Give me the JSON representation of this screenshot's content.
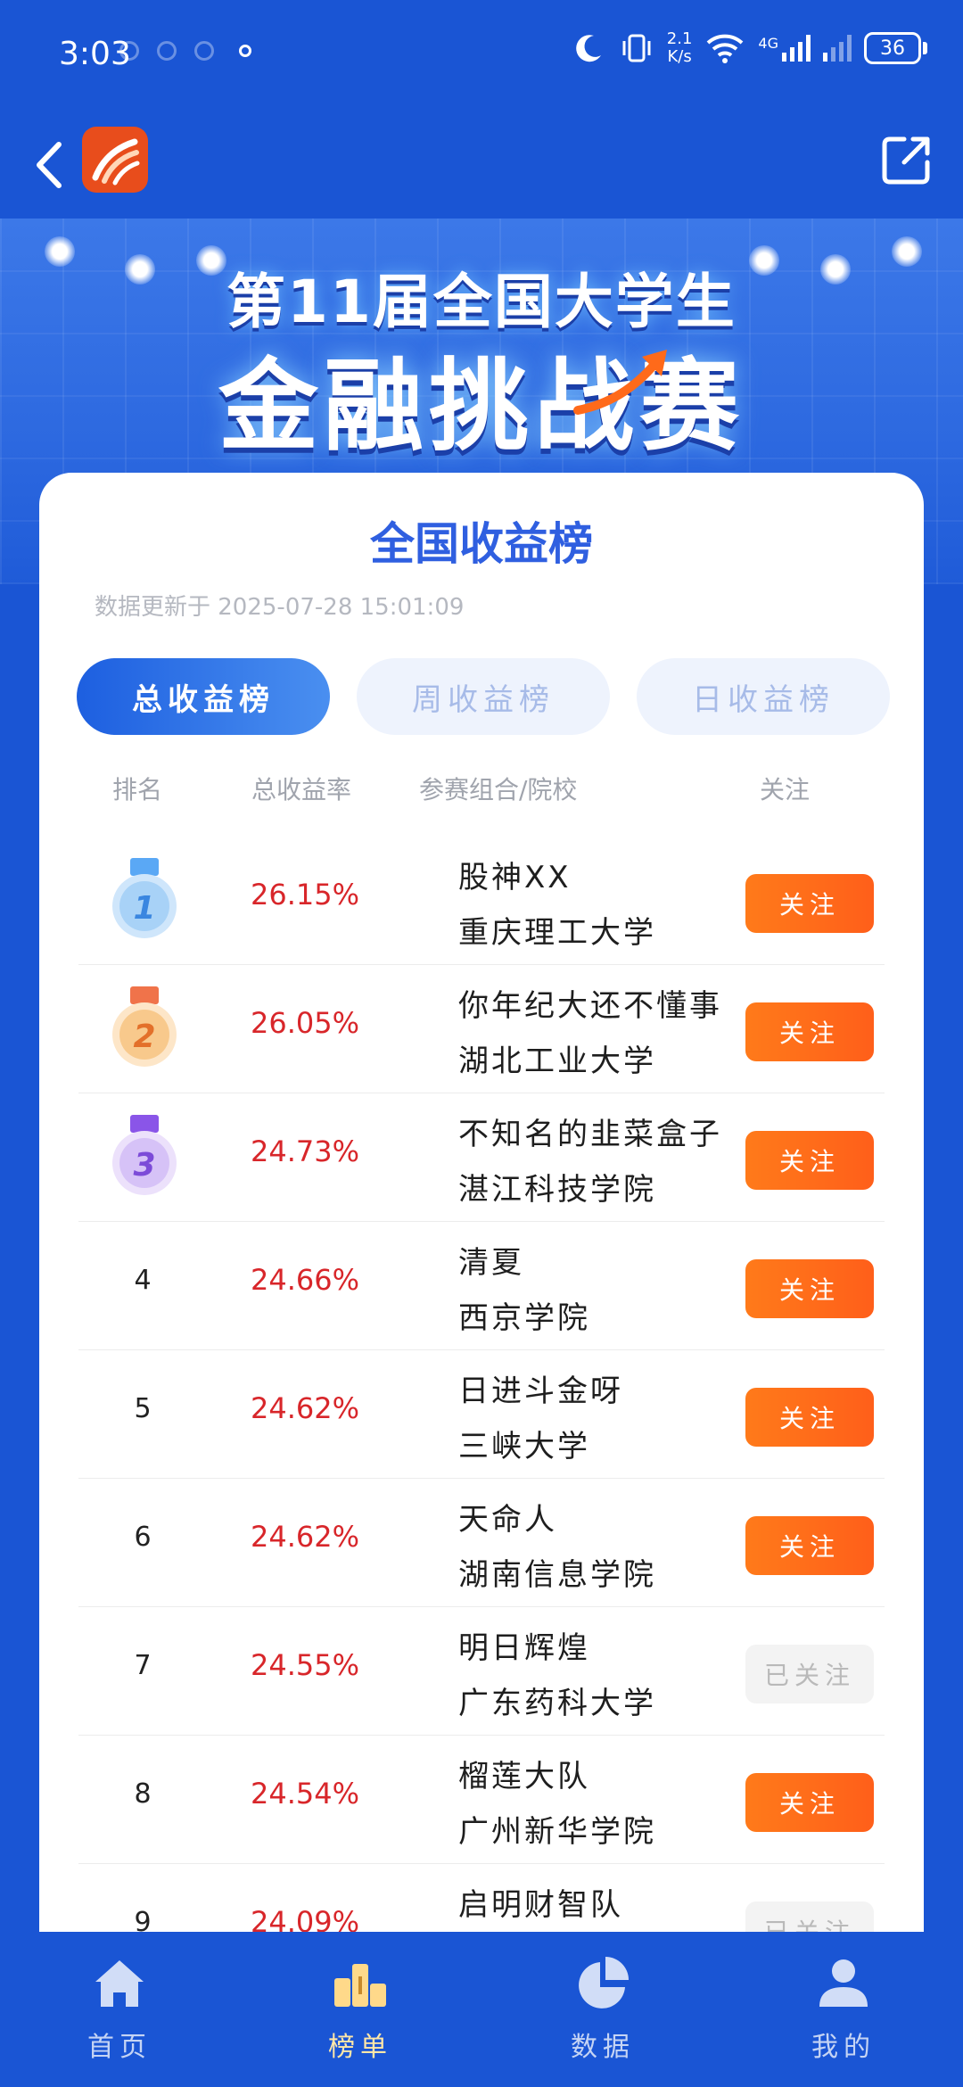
{
  "status_bar": {
    "time": "3:03",
    "net_speed_value": "2.1",
    "net_speed_unit": "K/s",
    "signal_label": "4G",
    "battery": "36"
  },
  "banner": {
    "line1": "第11届全国大学生",
    "line2": "金融挑战赛"
  },
  "leaderboard": {
    "title": "全国收益榜",
    "update_time": "数据更新于 2025-07-28 15:01:09",
    "tabs": [
      {
        "label": "总收益榜",
        "active": true
      },
      {
        "label": "周收益榜",
        "active": false
      },
      {
        "label": "日收益榜",
        "active": false
      }
    ],
    "columns": {
      "rank": "排名",
      "rate": "总收益率",
      "team": "参赛组合/院校",
      "follow": "关注"
    },
    "rows": [
      {
        "rank": "1",
        "rate": "26.15%",
        "team": "股神XX",
        "school": "重庆理工大学",
        "follow": "关注",
        "followed": false
      },
      {
        "rank": "2",
        "rate": "26.05%",
        "team": "你年纪大还不懂事",
        "school": "湖北工业大学",
        "follow": "关注",
        "followed": false
      },
      {
        "rank": "3",
        "rate": "24.73%",
        "team": "不知名的韭菜盒子",
        "school": "湛江科技学院",
        "follow": "关注",
        "followed": false
      },
      {
        "rank": "4",
        "rate": "24.66%",
        "team": "清夏",
        "school": "西京学院",
        "follow": "关注",
        "followed": false
      },
      {
        "rank": "5",
        "rate": "24.62%",
        "team": "日进斗金呀",
        "school": "三峡大学",
        "follow": "关注",
        "followed": false
      },
      {
        "rank": "6",
        "rate": "24.62%",
        "team": "天命人",
        "school": "湖南信息学院",
        "follow": "关注",
        "followed": false
      },
      {
        "rank": "7",
        "rate": "24.55%",
        "team": "明日辉煌",
        "school": "广东药科大学",
        "follow": "已关注",
        "followed": true
      },
      {
        "rank": "8",
        "rate": "24.54%",
        "team": "榴莲大队",
        "school": "广州新华学院",
        "follow": "关注",
        "followed": false
      },
      {
        "rank": "9",
        "rate": "24.09%",
        "team": "启明财智队",
        "school": "",
        "follow": "已关注",
        "followed": true
      }
    ]
  },
  "bottom_nav": [
    {
      "label": "首页",
      "icon": "home-icon",
      "active": false
    },
    {
      "label": "榜单",
      "icon": "ranking-icon",
      "active": true
    },
    {
      "label": "数据",
      "icon": "pie-chart-icon",
      "active": false
    },
    {
      "label": "我的",
      "icon": "user-icon",
      "active": false
    }
  ],
  "colors": {
    "background": "#1a55d4",
    "accent_blue": "#2f5fe0",
    "rate_red": "#d8262a",
    "follow_orange": "#ff6a1a"
  }
}
